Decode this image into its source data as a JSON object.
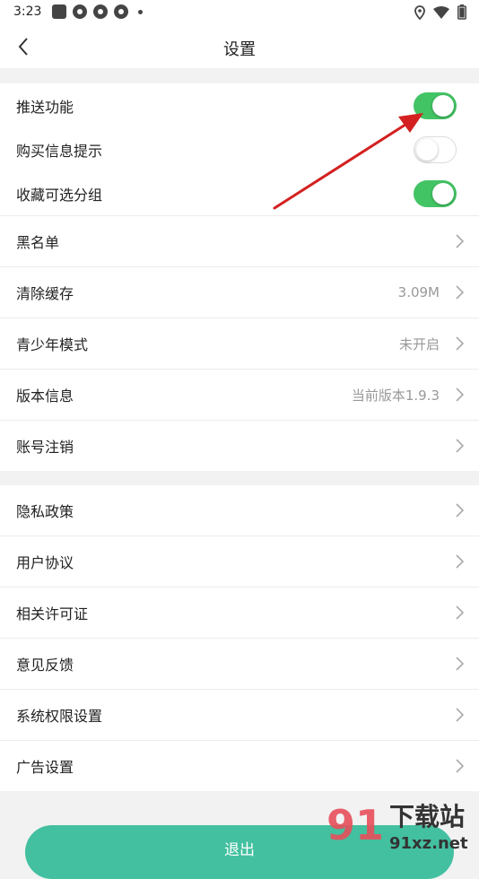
{
  "status_bar": {
    "time": "3:23"
  },
  "header": {
    "title": "设置",
    "back_icon": "chevron-left-icon"
  },
  "switch_group": [
    {
      "label": "推送功能",
      "on": true
    },
    {
      "label": "购买信息提示",
      "on": false
    },
    {
      "label": "收藏可选分组",
      "on": true
    }
  ],
  "group1": [
    {
      "label": "黑名单",
      "value": ""
    },
    {
      "label": "清除缓存",
      "value": "3.09M"
    },
    {
      "label": "青少年模式",
      "value": "未开启"
    },
    {
      "label": "版本信息",
      "value": "当前版本1.9.3"
    },
    {
      "label": "账号注销",
      "value": ""
    }
  ],
  "group2": [
    {
      "label": "隐私政策"
    },
    {
      "label": "用户协议"
    },
    {
      "label": "相关许可证"
    },
    {
      "label": "意见反馈"
    },
    {
      "label": "系统权限设置"
    },
    {
      "label": "广告设置"
    }
  ],
  "logout_label": "退出",
  "watermark": {
    "brand": "91",
    "text": "下载站",
    "site": "91xz.net"
  },
  "colors": {
    "switch_on": "#43c464",
    "logout": "#43c0a0",
    "arrow": "#d42020"
  }
}
